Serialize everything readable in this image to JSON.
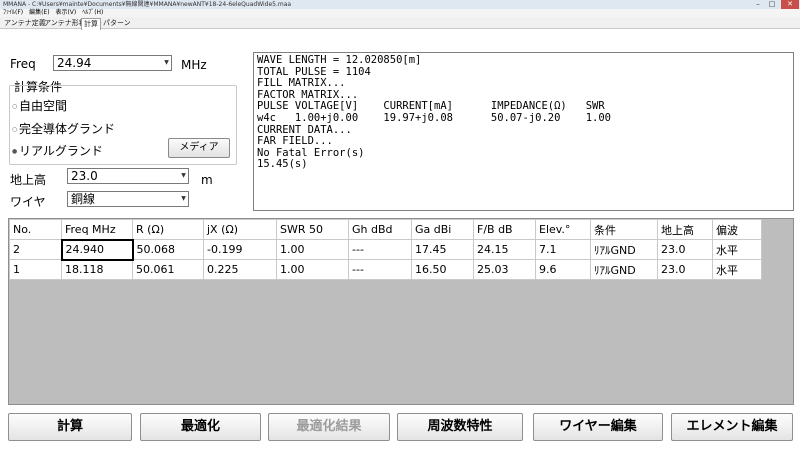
{
  "window": {
    "title": "MMANA - C:¥Users¥mainte¥Documents¥無線関連¥MMANA¥newANT¥18-24-6eleQuadWide5.maa"
  },
  "menu": [
    "ﾌｧｲﾙ(F)",
    "編集(E)",
    "表示(V)",
    "ﾍﾙﾌﾟ(H)"
  ],
  "tabs": [
    "アンテナ定義",
    "アンテナ形状",
    "計算",
    "パターン"
  ],
  "form": {
    "freq_label": "Freq",
    "freq_value": "24.94",
    "freq_unit": "MHz",
    "group_title": "計算条件",
    "radio_free": "自由空間",
    "radio_perfect": "完全導体グランド",
    "radio_real": "リアルグランド",
    "media_button": "メディア",
    "height_label": "地上高",
    "height_value": "23.0",
    "height_unit": "m",
    "wire_label": "ワイヤ",
    "wire_value": "銅線"
  },
  "output_lines": [
    "WAVE LENGTH = 12.020850[m]",
    "TOTAL PULSE = 1104",
    "FILL MATRIX...",
    "FACTOR MATRIX...",
    "PULSE VOLTAGE[V]    CURRENT[mA]      IMPEDANCE(Ω)   SWR",
    "w4c   1.00+j0.00    19.97+j0.08      50.07-j0.20    1.00",
    "CURRENT DATA...",
    "FAR FIELD...",
    "No Fatal Error(s)",
    "15.45(s)"
  ],
  "table": {
    "headers": [
      "No.",
      "Freq MHz",
      "R (Ω)",
      "jX (Ω)",
      "SWR 50",
      "Gh dBd",
      "Ga dBi",
      "F/B dB",
      "Elev.°",
      "条件",
      "地上高",
      "偏波"
    ],
    "rows": [
      [
        "2",
        "24.940",
        "50.068",
        "-0.199",
        "1.00",
        "---",
        "17.45",
        "24.15",
        "7.1",
        "ﾘｱﾙGND",
        "23.0",
        "水平"
      ],
      [
        "1",
        "18.118",
        "50.061",
        "0.225",
        "1.00",
        "---",
        "16.50",
        "25.03",
        "9.6",
        "ﾘｱﾙGND",
        "23.0",
        "水平"
      ]
    ]
  },
  "buttons": {
    "calc": "計算",
    "optimize": "最適化",
    "opt_result": "最適化結果",
    "freq_char": "周波数特性",
    "wire_edit": "ワイヤー編集",
    "element_edit": "エレメント編集"
  }
}
